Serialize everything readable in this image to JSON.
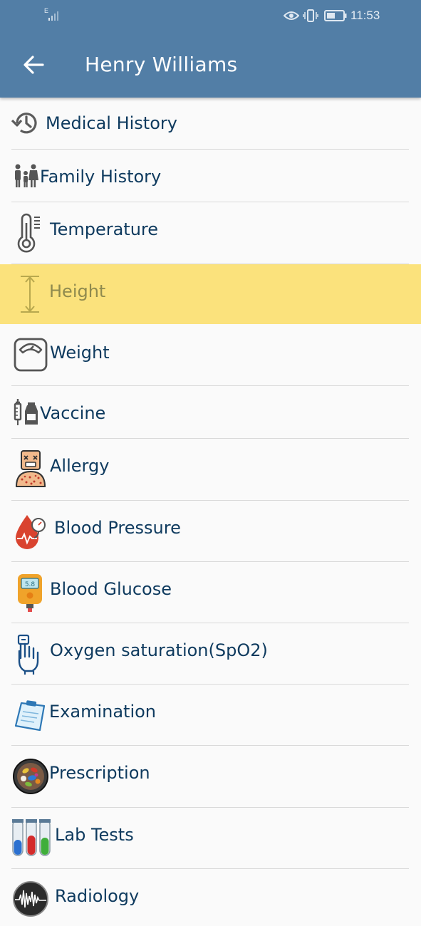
{
  "status_bar": {
    "network": "E",
    "time": "11:53"
  },
  "header": {
    "title": "Henry Williams",
    "back_icon": "arrow-left-icon"
  },
  "menu": [
    {
      "label": "Medical History",
      "icon": "history-icon"
    },
    {
      "label": "Family History",
      "icon": "family-icon"
    },
    {
      "label": "Temperature",
      "icon": "thermometer-icon"
    },
    {
      "label": "Height",
      "icon": "height-icon",
      "highlighted": true
    },
    {
      "label": "Weight",
      "icon": "scale-icon"
    },
    {
      "label": "Vaccine",
      "icon": "vaccine-icon"
    },
    {
      "label": "Allergy",
      "icon": "allergy-icon"
    },
    {
      "label": "Blood Pressure",
      "icon": "blood-pressure-icon"
    },
    {
      "label": "Blood Glucose",
      "icon": "glucometer-icon",
      "reading": "5.8"
    },
    {
      "label": "Oxygen saturation(SpO2)",
      "icon": "oximeter-hand-icon"
    },
    {
      "label": "Examination",
      "icon": "clipboard-icon"
    },
    {
      "label": "Prescription",
      "icon": "pills-icon"
    },
    {
      "label": "Lab Tests",
      "icon": "test-tubes-icon"
    },
    {
      "label": "Radiology",
      "icon": "radiology-icon"
    }
  ],
  "colors": {
    "appbar": "#527ea6",
    "highlight": "#fbe27c",
    "label": "#0e3a5e"
  }
}
